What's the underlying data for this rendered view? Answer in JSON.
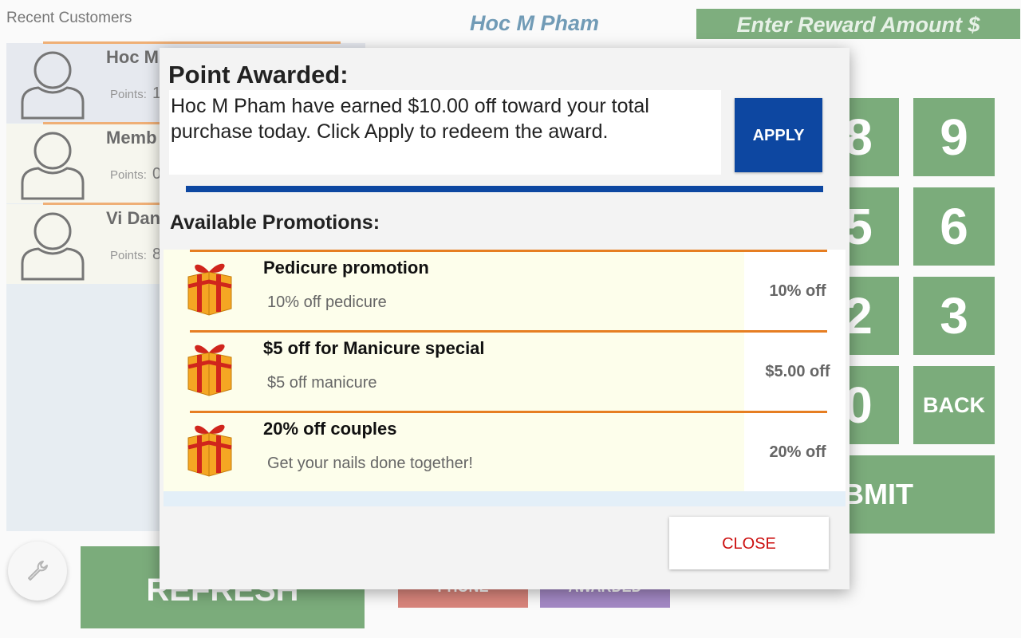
{
  "recent_customers": {
    "title": "Recent Customers",
    "items": [
      {
        "name": "Hoc M",
        "points_label": "Points:",
        "points": "1"
      },
      {
        "name": "Memb",
        "points_label": "Points:",
        "points": "0"
      },
      {
        "name": "Vi Dan",
        "points_label": "Points:",
        "points": "8"
      }
    ]
  },
  "header": {
    "customer_name": "Hoc M Pham",
    "reward_placeholder": "Enter Reward Amount $"
  },
  "keypad": {
    "keys": [
      "8",
      "9",
      "5",
      "6",
      "2",
      "3",
      "0",
      "BACK"
    ],
    "submit": "BMIT"
  },
  "bottom": {
    "refresh": "REFRESH",
    "phone": "PHONE",
    "awarded": "AWARDED"
  },
  "dialog": {
    "title": "Point Awarded:",
    "message": "Hoc M Pham have earned $10.00 off toward your total purchase today. Click Apply to redeem the award.",
    "apply": "APPLY",
    "promotions_title": "Available Promotions:",
    "promotions": [
      {
        "name": "Pedicure promotion",
        "description": "10% off pedicure",
        "value": "10% off"
      },
      {
        "name": "$5 off for Manicure special",
        "description": "$5 off manicure",
        "value": "$5.00 off"
      },
      {
        "name": "20% off couples",
        "description": "Get your nails done together!",
        "value": "20% off"
      }
    ],
    "close": "CLOSE"
  },
  "colors": {
    "accent_green": "#2b7a2b",
    "apply_blue": "#0d47a1",
    "divider_orange": "#e67e22",
    "close_red": "#cc1111"
  },
  "icons": [
    "user-avatar-icon",
    "gift-icon",
    "wrench-icon"
  ]
}
